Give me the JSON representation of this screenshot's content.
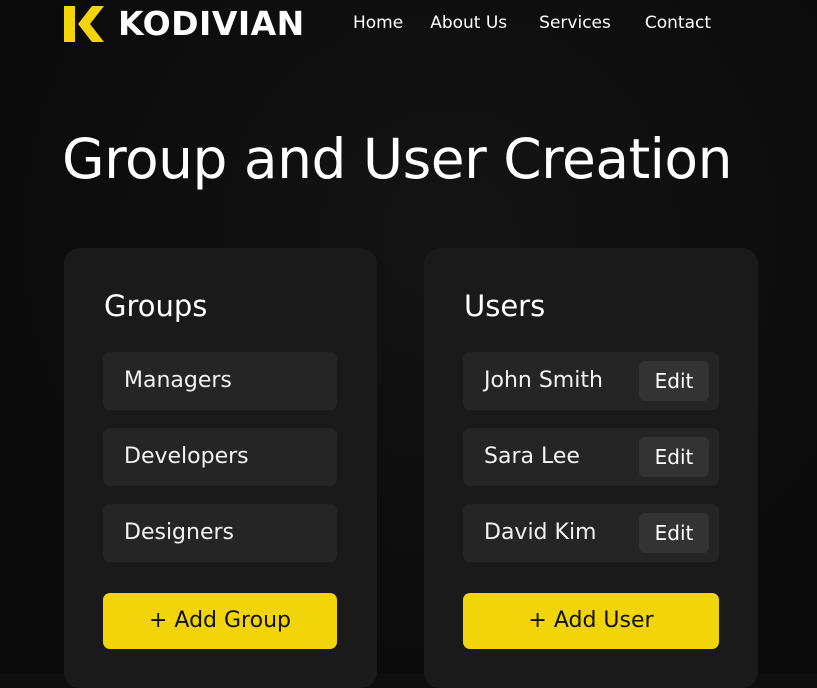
{
  "brand": {
    "name": "KODIVIAN",
    "accent_color": "#f2d40a"
  },
  "nav": {
    "items": [
      {
        "label": "Home"
      },
      {
        "label": "About Us"
      },
      {
        "label": "Services"
      },
      {
        "label": "Contact"
      }
    ]
  },
  "page": {
    "title": "Group and User Creation"
  },
  "groups": {
    "heading": "Groups",
    "items": [
      {
        "label": "Managers"
      },
      {
        "label": "Developers"
      },
      {
        "label": "Designers"
      }
    ],
    "add_label": "+ Add Group"
  },
  "users": {
    "heading": "Users",
    "items": [
      {
        "name": "John Smith",
        "action": "Edit"
      },
      {
        "name": "Sara Lee",
        "action": "Edit"
      },
      {
        "name": "David Kim",
        "action": "Edit"
      }
    ],
    "add_label": "+ Add User"
  },
  "icons": {
    "logo": "kodivian-k-logo-icon"
  }
}
